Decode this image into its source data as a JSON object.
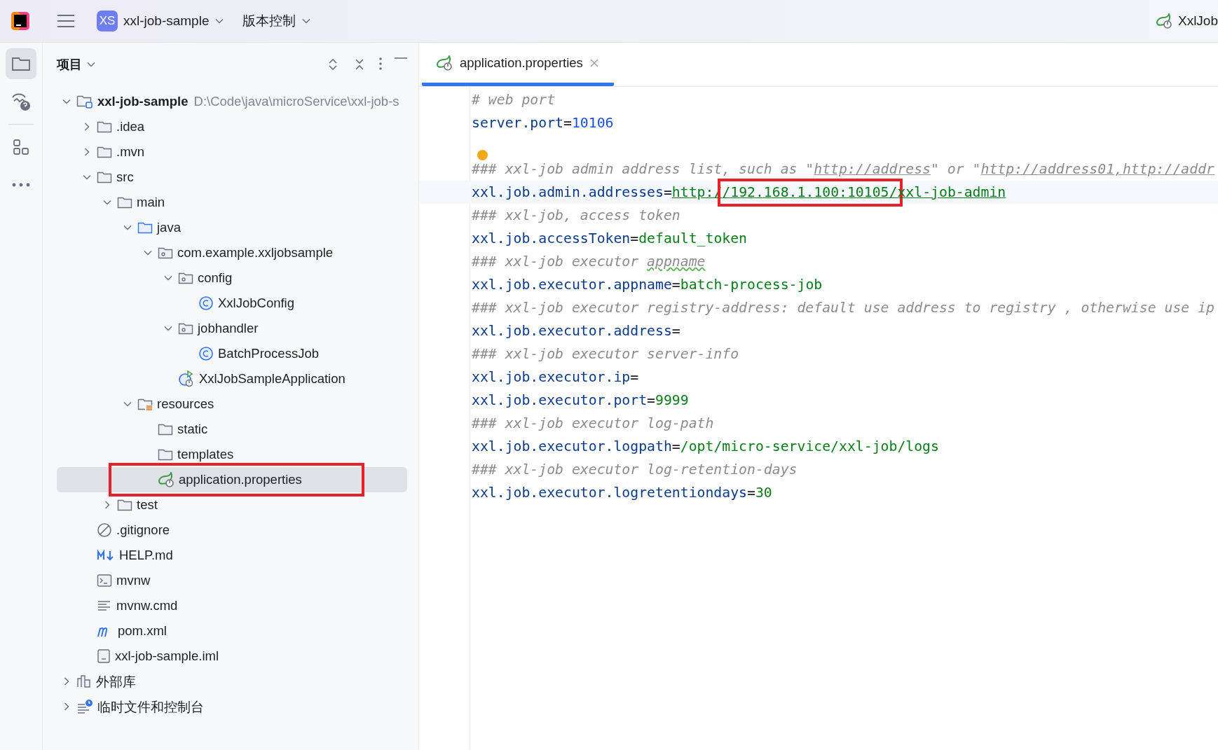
{
  "titlebar": {
    "project_badge": "XS",
    "project_name": "xxl-job-sample",
    "vcs_menu": "版本控制",
    "run_config": "XxlJob"
  },
  "sidebar": {
    "tools": [
      {
        "kind": "folder",
        "selected": true
      },
      {
        "kind": "learn",
        "selected": false
      },
      {
        "kind": "structure",
        "selected": false
      },
      {
        "kind": "more",
        "selected": false
      }
    ]
  },
  "project_panel": {
    "title": "项目",
    "tree": [
      {
        "label": "xxl-job-sample",
        "path": "D:\\Code\\java\\microService\\xxl-job-s",
        "kind": "module",
        "expanded": true,
        "selected": false,
        "children": [
          {
            "label": ".idea",
            "kind": "folder",
            "expanded": false,
            "selected": false
          },
          {
            "label": ".mvn",
            "kind": "folder",
            "expanded": false,
            "selected": false
          },
          {
            "label": "src",
            "kind": "folder",
            "expanded": true,
            "selected": false,
            "children": [
              {
                "label": "main",
                "kind": "folder",
                "expanded": true,
                "selected": false,
                "children": [
                  {
                    "label": "java",
                    "kind": "source",
                    "expanded": true,
                    "selected": false,
                    "children": [
                      {
                        "label": "com.example.xxljobsample",
                        "kind": "package",
                        "expanded": true,
                        "selected": false,
                        "children": [
                          {
                            "label": "config",
                            "kind": "package",
                            "expanded": true,
                            "selected": false,
                            "children": [
                              {
                                "label": "XxlJobConfig",
                                "kind": "class",
                                "selected": false
                              }
                            ]
                          },
                          {
                            "label": "jobhandler",
                            "kind": "package",
                            "expanded": true,
                            "selected": false,
                            "children": [
                              {
                                "label": "BatchProcessJob",
                                "kind": "class",
                                "selected": false
                              }
                            ]
                          },
                          {
                            "label": "XxlJobSampleApplication",
                            "kind": "spring-app",
                            "selected": false
                          }
                        ]
                      }
                    ]
                  },
                  {
                    "label": "resources",
                    "kind": "resources",
                    "expanded": true,
                    "selected": false,
                    "children": [
                      {
                        "label": "static",
                        "kind": "folder",
                        "selected": false
                      },
                      {
                        "label": "templates",
                        "kind": "folder",
                        "selected": false
                      },
                      {
                        "label": "application.properties",
                        "kind": "spring",
                        "selected": true,
                        "highlight": true
                      }
                    ]
                  }
                ]
              },
              {
                "label": "test",
                "kind": "folder",
                "expanded": false,
                "selected": false
              }
            ]
          },
          {
            "label": ".gitignore",
            "kind": "ignore",
            "selected": false
          },
          {
            "label": "HELP.md",
            "kind": "markdown",
            "selected": false
          },
          {
            "label": "mvnw",
            "kind": "shell",
            "selected": false
          },
          {
            "label": "mvnw.cmd",
            "kind": "text",
            "selected": false
          },
          {
            "label": "pom.xml",
            "kind": "maven",
            "selected": false
          },
          {
            "label": "xxl-job-sample.iml",
            "kind": "iml",
            "selected": false
          }
        ]
      },
      {
        "label": "外部库",
        "kind": "library",
        "expanded": false,
        "selected": false
      },
      {
        "label": "临时文件和控制台",
        "kind": "scratch",
        "expanded": false,
        "selected": false
      }
    ]
  },
  "editor": {
    "tabs": [
      {
        "label": "application.properties",
        "selected": true
      }
    ],
    "lines": [
      {
        "current": false,
        "segments": [
          {
            "kind": "comment",
            "text": "# web port"
          }
        ]
      },
      {
        "current": false,
        "segments": [
          {
            "kind": "key",
            "text": "server.port"
          },
          {
            "kind": "op",
            "text": "="
          },
          {
            "kind": "number",
            "text": "10106"
          }
        ]
      },
      {
        "current": false
      },
      {
        "current": false,
        "warning": true,
        "segments": [
          {
            "kind": "comment",
            "text": "### xxl-job admin address list, such as \""
          },
          {
            "kind": "comment-link",
            "text": "http://address"
          },
          {
            "kind": "comment",
            "text": "\" or \""
          },
          {
            "kind": "comment-link",
            "text": "http://address01,http://addr"
          }
        ]
      },
      {
        "current": true,
        "segments": [
          {
            "kind": "key",
            "text": "xxl.job.admin.addresses"
          },
          {
            "kind": "op",
            "text": "="
          },
          {
            "kind": "link",
            "text": "http:/"
          },
          {
            "kind": "link",
            "text": "/192.168.1.100:10105/",
            "highlight": true
          },
          {
            "kind": "link",
            "text": "xxl-job-admin"
          }
        ]
      },
      {
        "current": false,
        "segments": [
          {
            "kind": "comment",
            "text": "### xxl-job, access token"
          }
        ]
      },
      {
        "current": false,
        "segments": [
          {
            "kind": "key",
            "text": "xxl.job.accessToken"
          },
          {
            "kind": "op",
            "text": "="
          },
          {
            "kind": "string",
            "text": "default_token"
          }
        ]
      },
      {
        "current": false,
        "segments": [
          {
            "kind": "comment",
            "text": "### xxl-job executor "
          },
          {
            "kind": "comment-typo",
            "text": "appname"
          }
        ]
      },
      {
        "current": false,
        "segments": [
          {
            "kind": "key",
            "text": "xxl.job.executor.appname"
          },
          {
            "kind": "op",
            "text": "="
          },
          {
            "kind": "string",
            "text": "batch-process-job"
          }
        ]
      },
      {
        "current": false,
        "segments": [
          {
            "kind": "comment",
            "text": "### xxl-job executor registry-address: default use address to registry , otherwise use ip"
          }
        ]
      },
      {
        "current": false,
        "segments": [
          {
            "kind": "key",
            "text": "xxl.job.executor.address"
          },
          {
            "kind": "op",
            "text": "="
          }
        ]
      },
      {
        "current": false,
        "segments": [
          {
            "kind": "comment",
            "text": "### xxl-job executor server-info"
          }
        ]
      },
      {
        "current": false,
        "segments": [
          {
            "kind": "key",
            "text": "xxl.job.executor.ip"
          },
          {
            "kind": "op",
            "text": "="
          }
        ]
      },
      {
        "current": false,
        "segments": [
          {
            "kind": "key",
            "text": "xxl.job.executor.port"
          },
          {
            "kind": "op",
            "text": "="
          },
          {
            "kind": "string",
            "text": "9999"
          }
        ]
      },
      {
        "current": false,
        "segments": [
          {
            "kind": "comment",
            "text": "### xxl-job executor log-path"
          }
        ]
      },
      {
        "current": false,
        "segments": [
          {
            "kind": "key",
            "text": "xxl.job.executor.logpath"
          },
          {
            "kind": "op",
            "text": "="
          },
          {
            "kind": "string",
            "text": "/opt/micro-service/xxl-job/logs"
          }
        ]
      },
      {
        "current": false,
        "segments": [
          {
            "kind": "comment",
            "text": "### xxl-job executor log-retention-days"
          }
        ]
      },
      {
        "current": false,
        "segments": [
          {
            "kind": "key",
            "text": "xxl.job.executor.logretentiondays"
          },
          {
            "kind": "op",
            "text": "="
          },
          {
            "kind": "string",
            "text": "30"
          }
        ]
      }
    ]
  }
}
